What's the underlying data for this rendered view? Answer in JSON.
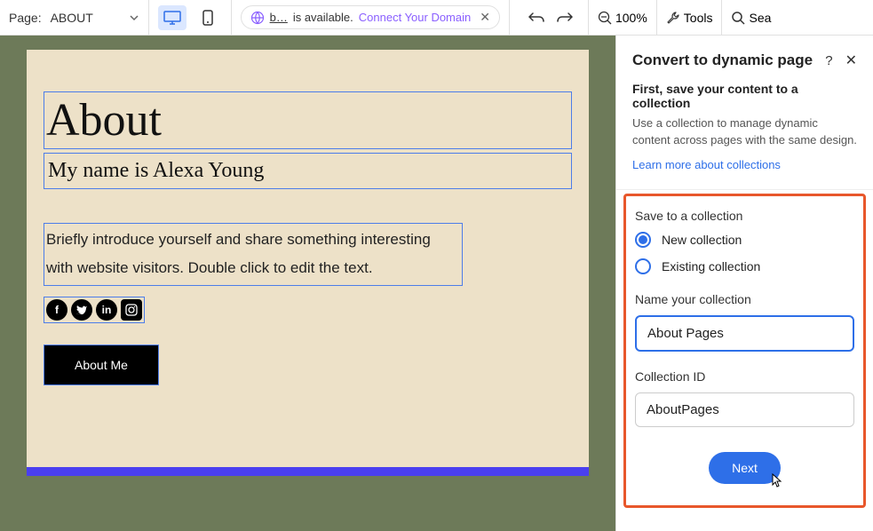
{
  "topbar": {
    "page_label": "Page:",
    "page_name": "ABOUT",
    "domain": {
      "name": "b…",
      "available_text": "is available.",
      "connect_text": "Connect Your Domain"
    },
    "zoom": "100%",
    "tools_label": "Tools",
    "search_label": "Sea"
  },
  "canvas": {
    "heading": "About",
    "subheading": "My name is Alexa Young",
    "body": "Briefly introduce yourself and share something interesting with website visitors. Double click to edit the text.",
    "button_label": "About Me",
    "social": [
      "facebook-icon",
      "twitter-icon",
      "linkedin-icon",
      "instagram-icon"
    ]
  },
  "panel": {
    "title": "Convert to dynamic page",
    "intro_bold": "First, save your content to a collection",
    "intro_desc": "Use a collection to manage dynamic content across pages with the same design.",
    "learn_link": "Learn more about collections",
    "save_label": "Save to a collection",
    "radio_new": "New collection",
    "radio_existing": "Existing collection",
    "name_label": "Name your collection",
    "name_value": "About Pages",
    "id_label": "Collection ID",
    "id_value": "AboutPages",
    "next_label": "Next"
  }
}
